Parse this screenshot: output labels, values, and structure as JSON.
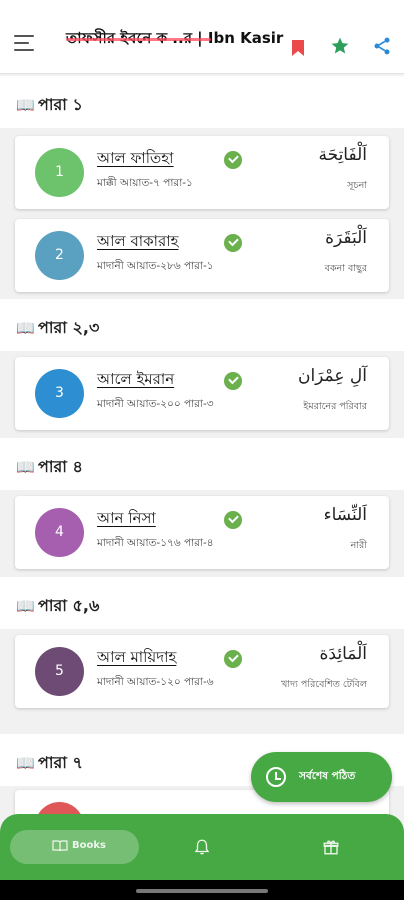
{
  "app_bar": {
    "title": "তাফসীর ইবনে ক ..র | Ibn Kasir",
    "icons": [
      "menu-icon",
      "bookmark-icon",
      "star-icon",
      "share-icon"
    ],
    "colors": {
      "bookmark": "#ea4a4a",
      "star": "#2e9e5b",
      "share": "#2a8ad8"
    }
  },
  "sections": [
    {
      "label": "পারা ১"
    },
    {
      "label": "পারা ২,৩"
    },
    {
      "label": "পারা ৪"
    },
    {
      "label": "পারা ৫,৬"
    },
    {
      "label": "পারা ৭"
    }
  ],
  "surahs": [
    {
      "number": "1",
      "name": "আল ফাতিহা",
      "meta": "মাক্কী আয়াত-৭ পারা-১",
      "arabic": "اَلْفَاتِحَة",
      "meaning": "সূচনা",
      "color": "#6cc36b",
      "completed": true
    },
    {
      "number": "2",
      "name": "আল বাকারাহ",
      "meta": "মাদানী আয়াত-২৮৬ পারা-১",
      "arabic": "اَلْبَقَرَة",
      "meaning": "বকনা বাছুর",
      "color": "#5aa0c0",
      "completed": true
    },
    {
      "number": "3",
      "name": "আলে ইমরান",
      "meta": "মাদানী আয়াত-২০০ পারা-৩",
      "arabic": "آلِ عِمْرَان",
      "meaning": "ইমরানের পরিবার",
      "color": "#2d8fd1",
      "completed": true
    },
    {
      "number": "4",
      "name": "আন নিসা",
      "meta": "মাদানী আয়াত-১৭৬ পারা-৪",
      "arabic": "اَلنِّسَاء",
      "meaning": "নারী",
      "color": "#a65fae",
      "completed": true
    },
    {
      "number": "5",
      "name": "আল মায়িদাহ",
      "meta": "মাদানী আয়াত-১২০ পারা-৬",
      "arabic": "اَلْمَائِدَة",
      "meaning": "খাদ্য পরিবেশিত টেবিল",
      "color": "#6e4b74",
      "completed": true
    }
  ],
  "fab": {
    "label": "সর্বশেষ পঠিত",
    "icon": "history-icon"
  },
  "bottom_nav": {
    "books_label": "Books",
    "items": [
      "books-icon",
      "bell-icon",
      "gift-icon"
    ],
    "active": "Books"
  },
  "colors": {
    "primary": "#47a944",
    "check": "#6ab04c",
    "background": "#f1f1f1"
  }
}
